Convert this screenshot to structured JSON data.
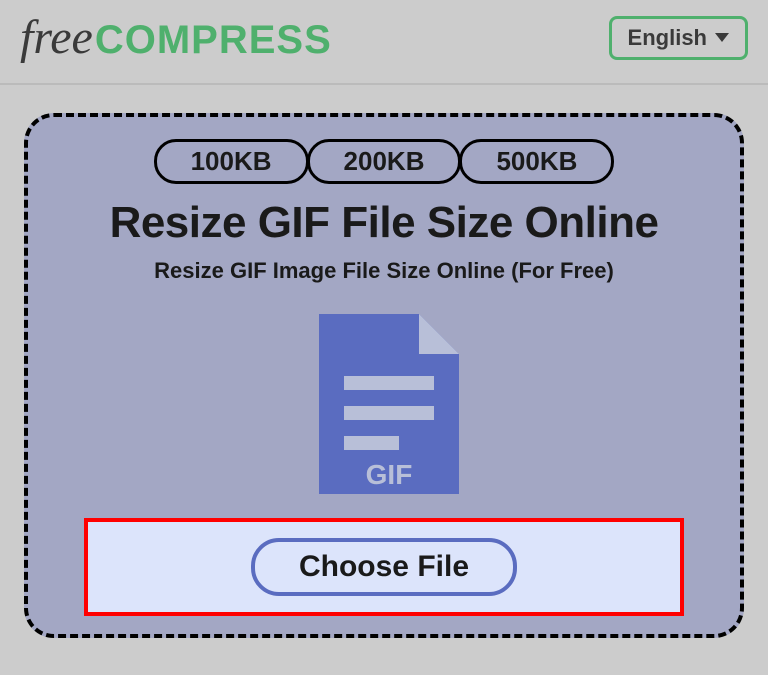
{
  "header": {
    "logo": {
      "free": "free",
      "compress": "COMPRESS"
    },
    "language": {
      "label": "English"
    }
  },
  "panel": {
    "sizePills": [
      "100KB",
      "200KB",
      "500KB"
    ],
    "title": "Resize GIF File Size Online",
    "subtitle": "Resize GIF Image File Size Online (For Free)",
    "fileIcon": {
      "label": "GIF"
    },
    "chooseFile": "Choose File"
  }
}
